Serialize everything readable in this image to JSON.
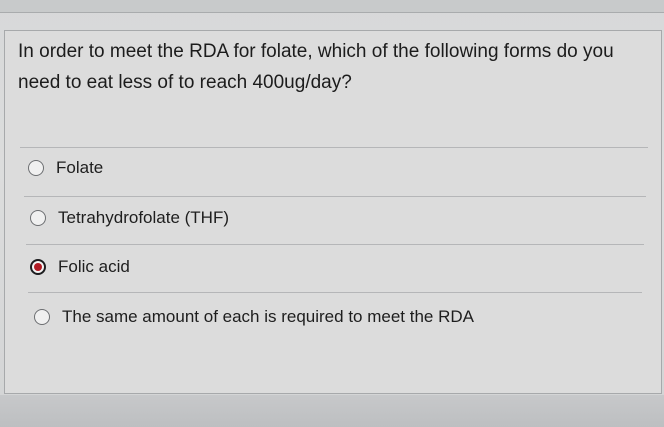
{
  "question": {
    "text": "In order to meet the RDA for folate, which of the following forms do you need to eat less of to reach 400ug/day?"
  },
  "options": [
    {
      "label": "Folate",
      "selected": false
    },
    {
      "label": "Tetrahydrofolate (THF)",
      "selected": false
    },
    {
      "label": "Folic acid",
      "selected": true
    },
    {
      "label": "The same amount of each is required to meet the RDA",
      "selected": false
    }
  ],
  "colors": {
    "selected_dot": "#b01b24",
    "background": "#dcdcdc"
  }
}
